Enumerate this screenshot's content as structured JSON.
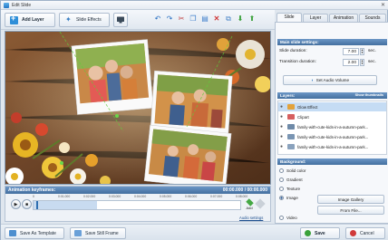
{
  "window": {
    "title": "Edit Slide",
    "close_glyph": "✕"
  },
  "toolbar": {
    "add_layer": "Add Layer",
    "slide_effects": "Slide Effects",
    "icons": [
      "undo-icon",
      "redo-icon",
      "cut-icon",
      "copy-icon",
      "paste-icon",
      "delete-icon",
      "duplicate-icon",
      "move-down-icon",
      "move-up-icon"
    ]
  },
  "animation": {
    "title": "Animation keyframes:",
    "time": "00:00.000 / 00:00.000",
    "ruler": [
      "0",
      "0:01.000",
      "0:02.000",
      "0:03.000",
      "0:04.000",
      "0:05.000",
      "0:06.000",
      "0:07.000",
      "0:08.000"
    ],
    "add_label": "Add",
    "audio_settings": "Audio settings"
  },
  "bottom": {
    "save_template": "Save As Template",
    "save_still": "Save Still Frame",
    "save": "Save",
    "cancel": "Cancel"
  },
  "panel": {
    "tabs": [
      "Slide",
      "Layer",
      "Animation",
      "Sounds"
    ],
    "active_tab": "Slide",
    "main_settings": {
      "title": "Main slide settings:",
      "slide_duration_label": "Slide duration:",
      "slide_duration_value": "7.00",
      "transition_duration_label": "Transition duration:",
      "transition_duration_value": "2.00",
      "unit": "sec.",
      "audio_volume": "Set Audio Volume"
    },
    "layers": {
      "title": "Layers:",
      "show_thumbnails": "Show thumbnails",
      "items": [
        {
          "name": "Glow Effect",
          "color": "#e3a23a"
        },
        {
          "name": "Clipart",
          "color": "#d65f5f"
        },
        {
          "name": "family-with-cute-kids-in-a-autumn-park...",
          "color": "#6f8aa8"
        },
        {
          "name": "family-with-cute-kids-in-a-autumn-park...",
          "color": "#7a95b3"
        },
        {
          "name": "family-with-cute-kids-in-a-autumn-park...",
          "color": "#8aa2bd"
        }
      ],
      "selected_index": 0
    },
    "background": {
      "title": "Background:",
      "options": [
        "Solid color",
        "Gradient",
        "Texture",
        "Image",
        "Video"
      ],
      "selected": "Image",
      "image_gallery": "Image Gallery",
      "from_file": "From File..."
    }
  },
  "colors": {
    "accent": "#436f9f",
    "header_blue": "#6c97c6",
    "save_green": "#3aa13a",
    "cancel_red": "#d03a3a"
  }
}
